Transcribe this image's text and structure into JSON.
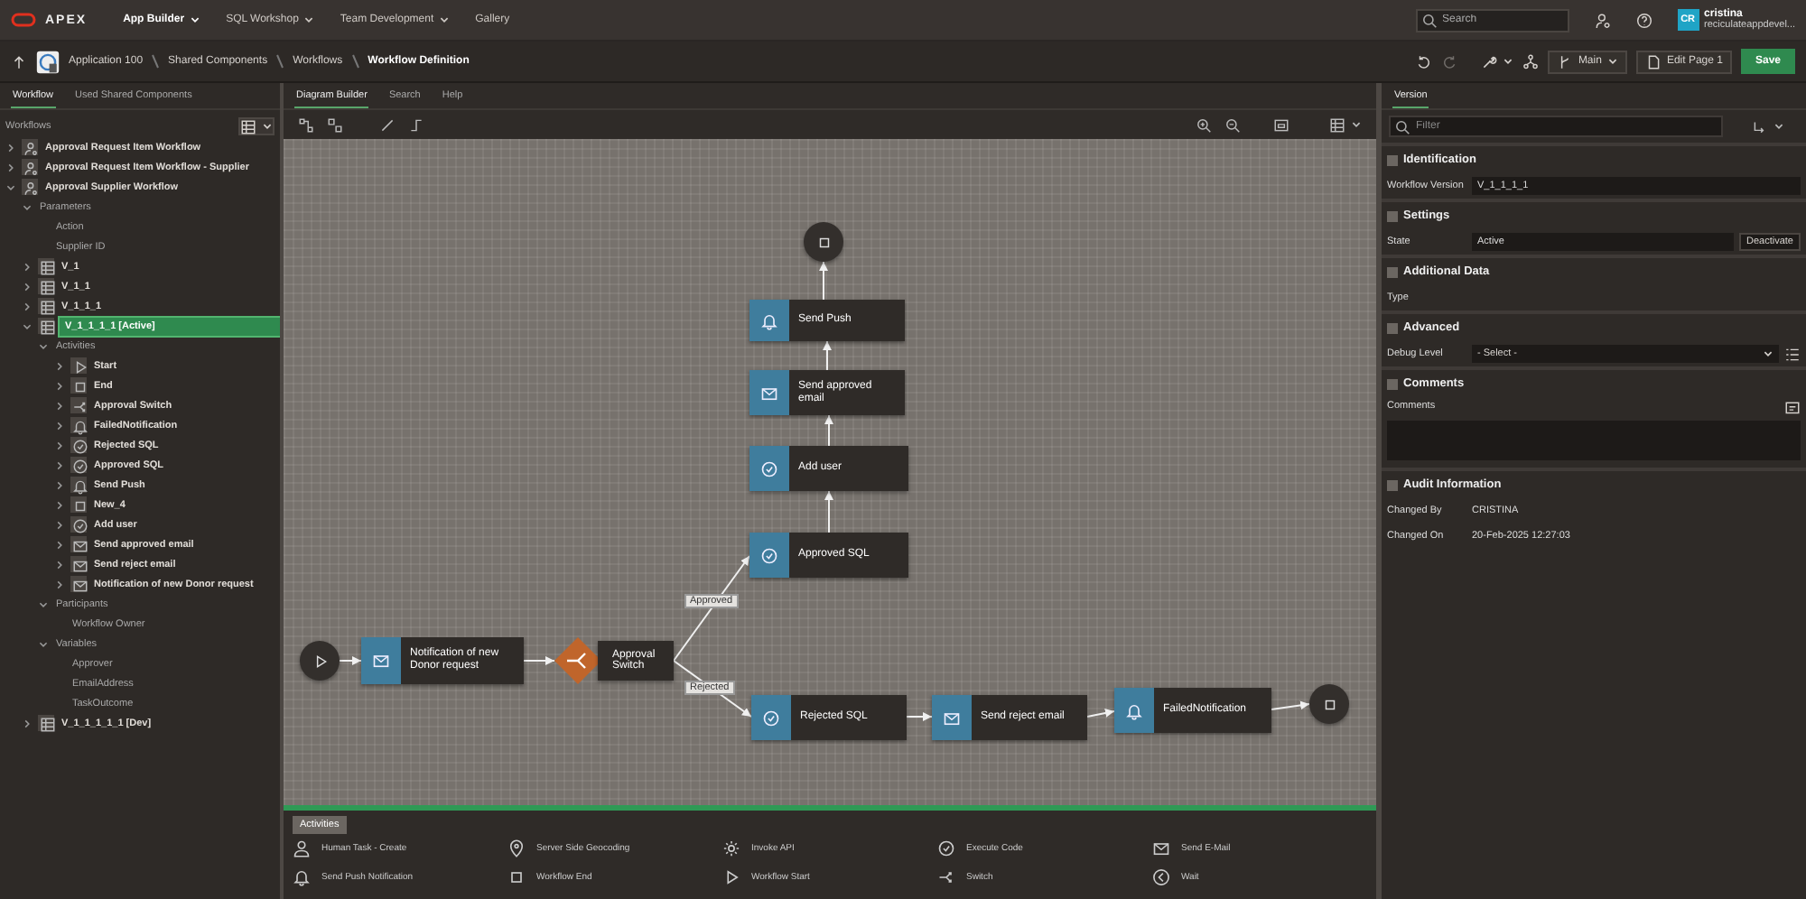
{
  "top_bar": {
    "brand": "APEX",
    "menus": [
      {
        "label": "App Builder",
        "selected": true,
        "kind": "menu"
      },
      {
        "label": "SQL Workshop",
        "selected": false,
        "kind": "menu"
      },
      {
        "label": "Team Development",
        "selected": false,
        "kind": "menu"
      },
      {
        "label": "Gallery",
        "selected": false,
        "kind": "link"
      }
    ],
    "search": {
      "placeholder": "Search"
    },
    "user": {
      "initials": "CR",
      "name": "cristina",
      "workspace": "reciculateappdevel..."
    }
  },
  "breadcrumb": [
    "Application 100",
    "Shared Components",
    "Workflows",
    "Workflow Definition"
  ],
  "page_toolbar": {
    "branch": "Main",
    "edit_page": "Edit Page 1",
    "save": "Save"
  },
  "left_panel": {
    "tabs": [
      {
        "label": "Workflow",
        "selected": true
      },
      {
        "label": "Used Shared Components",
        "selected": false
      }
    ],
    "heading": "Workflows",
    "tree": [
      {
        "label": "Approval Request Item Workflow",
        "kind": "workflow",
        "expanded": false,
        "selected": false
      },
      {
        "label": "Approval Request Item Workflow - Supplier",
        "kind": "workflow",
        "expanded": false,
        "selected": false
      },
      {
        "label": "Approval Supplier Workflow",
        "kind": "workflow",
        "expanded": true,
        "selected": false,
        "children": [
          {
            "label": "Parameters",
            "expanded": true,
            "selected": false,
            "children": [
              {
                "label": "Action",
                "selected": false
              },
              {
                "label": "Supplier ID",
                "selected": false
              }
            ]
          },
          {
            "label": "V_1",
            "kind": "version",
            "expanded": false,
            "selected": false
          },
          {
            "label": "V_1_1",
            "kind": "version",
            "expanded": false,
            "selected": false
          },
          {
            "label": "V_1_1_1",
            "kind": "version",
            "expanded": false,
            "selected": false
          },
          {
            "label": "V_1_1_1_1 [Active]",
            "kind": "version",
            "expanded": true,
            "selected": true,
            "children": [
              {
                "label": "Activities",
                "expanded": true,
                "selected": false,
                "children": [
                  {
                    "label": "Start",
                    "kind": "start",
                    "expanded": false,
                    "selected": false
                  },
                  {
                    "label": "End",
                    "kind": "end",
                    "expanded": false,
                    "selected": false
                  },
                  {
                    "label": "Approval Switch",
                    "kind": "switch",
                    "expanded": false,
                    "selected": false
                  },
                  {
                    "label": "FailedNotification",
                    "kind": "bell",
                    "expanded": false,
                    "selected": false
                  },
                  {
                    "label": "Rejected SQL",
                    "kind": "check",
                    "expanded": false,
                    "selected": false
                  },
                  {
                    "label": "Approved SQL",
                    "kind": "check",
                    "expanded": false,
                    "selected": false
                  },
                  {
                    "label": "Send Push",
                    "kind": "bell",
                    "expanded": false,
                    "selected": false
                  },
                  {
                    "label": "New_4",
                    "kind": "end",
                    "expanded": false,
                    "selected": false
                  },
                  {
                    "label": "Add user",
                    "kind": "check",
                    "expanded": false,
                    "selected": false
                  },
                  {
                    "label": "Send approved email",
                    "kind": "mail",
                    "expanded": false,
                    "selected": false
                  },
                  {
                    "label": "Send reject email",
                    "kind": "mail",
                    "expanded": false,
                    "selected": false
                  },
                  {
                    "label": "Notification of new Donor request",
                    "kind": "mail",
                    "expanded": false,
                    "selected": false
                  }
                ]
              },
              {
                "label": "Participants",
                "expanded": true,
                "selected": false,
                "children": [
                  {
                    "label": "Workflow Owner",
                    "selected": false
                  }
                ]
              },
              {
                "label": "Variables",
                "expanded": true,
                "selected": false,
                "children": [
                  {
                    "label": "Approver",
                    "selected": false
                  },
                  {
                    "label": "EmailAddress",
                    "selected": false
                  },
                  {
                    "label": "TaskOutcome",
                    "selected": false
                  }
                ]
              }
            ]
          },
          {
            "label": "V_1_1_1_1_1 [Dev]",
            "kind": "version",
            "expanded": false,
            "selected": false
          }
        ]
      }
    ]
  },
  "diagram": {
    "tabs": [
      {
        "label": "Diagram Builder",
        "selected": true
      },
      {
        "label": "Search",
        "selected": false
      },
      {
        "label": "Help",
        "selected": false
      }
    ],
    "nodes": [
      {
        "kind": "end"
      },
      {
        "kind": "bell",
        "label": "Send Push"
      },
      {
        "kind": "mail",
        "label": "Send approved email"
      },
      {
        "kind": "check",
        "label": "Add user"
      },
      {
        "kind": "check",
        "label": "Approved SQL"
      },
      {
        "kind": "start"
      },
      {
        "kind": "mail",
        "label": "Notification of new Donor request"
      },
      {
        "kind": "switch",
        "label": "Approval Switch"
      },
      {
        "kind": "check",
        "label": "Rejected SQL"
      },
      {
        "kind": "mail",
        "label": "Send reject email"
      },
      {
        "kind": "bell",
        "label": "FailedNotification"
      },
      {
        "kind": "end"
      }
    ],
    "edge_labels": [
      "Approved",
      "Rejected"
    ]
  },
  "palette": {
    "tabs": [
      {
        "label": "Activities",
        "selected": true
      }
    ],
    "items": [
      {
        "label": "Human Task - Create",
        "kind": "person"
      },
      {
        "label": "Server Side Geocoding",
        "kind": "pin"
      },
      {
        "label": "Invoke API",
        "kind": "gear"
      },
      {
        "label": "Execute Code",
        "kind": "check"
      },
      {
        "label": "Send E-Mail",
        "kind": "mail"
      },
      {
        "label": "Send Push Notification",
        "kind": "bell"
      },
      {
        "label": "Workflow End",
        "kind": "end"
      },
      {
        "label": "Workflow Start",
        "kind": "start"
      },
      {
        "label": "Switch",
        "kind": "switch"
      },
      {
        "label": "Wait",
        "kind": "wait"
      }
    ]
  },
  "right_panel": {
    "tabs": [
      {
        "label": "Version",
        "selected": true
      }
    ],
    "filter": {
      "placeholder": "Filter"
    },
    "sections": [
      {
        "title": "Identification",
        "fields": [
          {
            "label": "Workflow Version",
            "kind": "text",
            "value": "V_1_1_1_1"
          }
        ]
      },
      {
        "title": "Settings",
        "fields": [
          {
            "label": "State",
            "kind": "text",
            "value": "Active",
            "button": "Deactivate"
          }
        ]
      },
      {
        "title": "Additional Data",
        "fields": [
          {
            "label": "Type",
            "kind": "none"
          }
        ]
      },
      {
        "title": "Advanced",
        "fields": [
          {
            "label": "Debug Level",
            "kind": "select",
            "value": "- Select -"
          }
        ]
      },
      {
        "title": "Comments",
        "fields": [
          {
            "label": "Comments",
            "kind": "textarea"
          }
        ]
      },
      {
        "title": "Audit Information",
        "fields": [
          {
            "label": "Changed By",
            "kind": "plain",
            "value": "CRISTINA"
          },
          {
            "label": "Changed On",
            "kind": "plain",
            "value": "20-Feb-2025 12:27:03"
          }
        ]
      }
    ]
  }
}
